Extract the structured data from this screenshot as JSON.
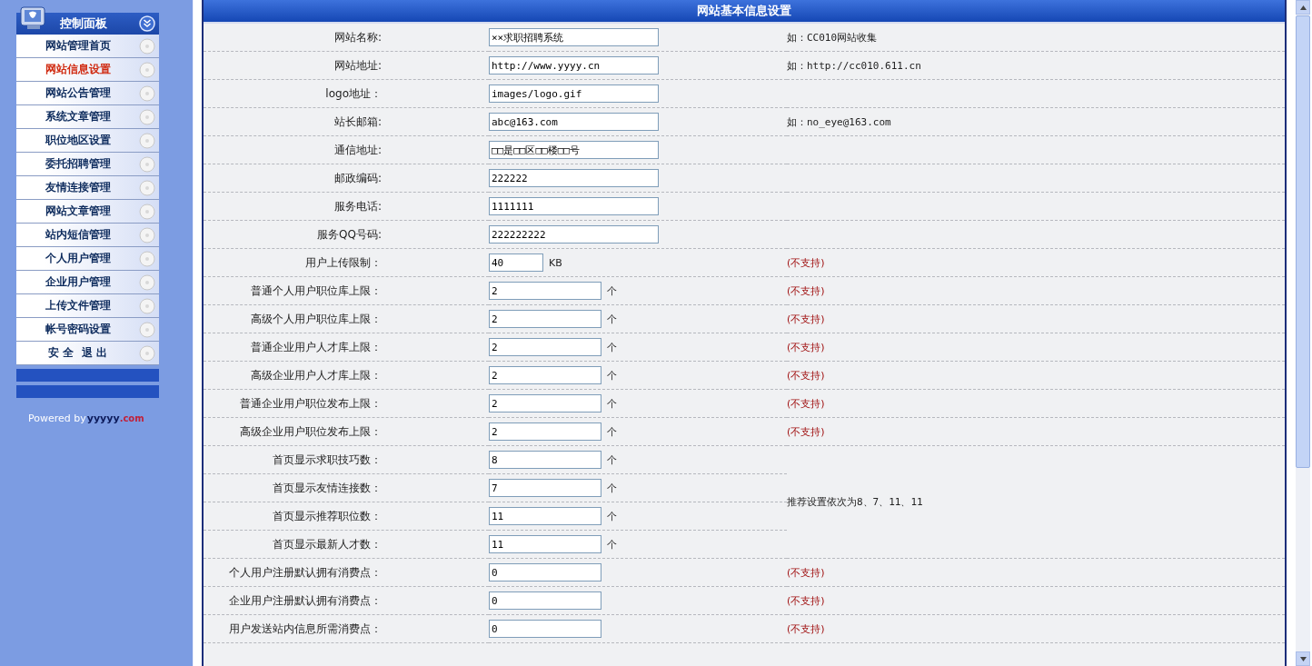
{
  "sidebar": {
    "title": "控制面板",
    "items": [
      {
        "label": "网站管理首页",
        "selected": false
      },
      {
        "label": "网站信息设置",
        "selected": true
      },
      {
        "label": "网站公告管理",
        "selected": false
      },
      {
        "label": "系统文章管理",
        "selected": false
      },
      {
        "label": "职位地区设置",
        "selected": false
      },
      {
        "label": "委托招聘管理",
        "selected": false
      },
      {
        "label": "友情连接管理",
        "selected": false
      },
      {
        "label": "网站文章管理",
        "selected": false
      },
      {
        "label": "站内短信管理",
        "selected": false
      },
      {
        "label": "个人用户管理",
        "selected": false
      },
      {
        "label": "企业用户管理",
        "selected": false
      },
      {
        "label": "上传文件管理",
        "selected": false
      },
      {
        "label": "帐号密码设置",
        "selected": false
      },
      {
        "label": "安 全  退 出",
        "selected": false
      }
    ],
    "powered_by": "Powered by",
    "brand": "yyyyy",
    "brand_suffix": ".com"
  },
  "panel": {
    "title": "网站基本信息设置",
    "rows": [
      {
        "kind": "wide",
        "label": "网站名称:",
        "value": "××求职招聘系统",
        "note": {
          "kind": "hint",
          "text": "如：CC010网站收集"
        }
      },
      {
        "kind": "wide",
        "label": "网站地址:",
        "value": "http://www.yyyy.cn",
        "note": {
          "kind": "hint",
          "text": "如：http://cc010.611.cn"
        }
      },
      {
        "kind": "wide",
        "label": "logo地址：",
        "value": "images/logo.gif"
      },
      {
        "kind": "wide",
        "label": "站长邮箱:",
        "value": "abc@163.com",
        "note": {
          "kind": "hint",
          "text": "如：no_eye@163.com"
        }
      },
      {
        "kind": "wide",
        "label": "通信地址:",
        "value": "□□是□□区□□楼□□号"
      },
      {
        "kind": "wide",
        "label": "邮政编码:",
        "value": "222222"
      },
      {
        "kind": "wide",
        "label": "服务电话:",
        "value": "1111111"
      },
      {
        "kind": "wide",
        "label": "服务QQ号码:",
        "value": "222222222"
      },
      {
        "kind": "small",
        "label": "用户上传限制：",
        "value": "40",
        "unit": "KB",
        "note": {
          "kind": "unsupported",
          "text": "(不支持)"
        }
      },
      {
        "kind": "medium",
        "label": "普通个人用户职位库上限：",
        "value": "2",
        "unit": "个",
        "note": {
          "kind": "unsupported",
          "text": "(不支持)"
        }
      },
      {
        "kind": "medium",
        "label": "高级个人用户职位库上限：",
        "value": "2",
        "unit": "个",
        "note": {
          "kind": "unsupported",
          "text": "(不支持)"
        }
      },
      {
        "kind": "medium",
        "label": "普通企业用户人才库上限：",
        "value": "2",
        "unit": "个",
        "note": {
          "kind": "unsupported",
          "text": "(不支持)"
        }
      },
      {
        "kind": "medium",
        "label": "高级企业用户人才库上限：",
        "value": "2",
        "unit": "个",
        "note": {
          "kind": "unsupported",
          "text": "(不支持)"
        }
      },
      {
        "kind": "medium",
        "label": "普通企业用户职位发布上限：",
        "value": "2",
        "unit": "个",
        "note": {
          "kind": "unsupported",
          "text": "(不支持)"
        }
      },
      {
        "kind": "medium",
        "label": "高级企业用户职位发布上限：",
        "value": "2",
        "unit": "个",
        "note": {
          "kind": "unsupported",
          "text": "(不支持)"
        }
      },
      {
        "kind": "group",
        "note": {
          "kind": "hint",
          "text": "推荐设置依次为8、7、11、11"
        },
        "rows": [
          {
            "kind": "medium",
            "label": "首页显示求职技巧数：",
            "value": "8",
            "unit": "个"
          },
          {
            "kind": "medium",
            "label": "首页显示友情连接数：",
            "value": "7",
            "unit": "个"
          },
          {
            "kind": "medium",
            "label": "首页显示推荐职位数：",
            "value": "11",
            "unit": "个"
          },
          {
            "kind": "medium",
            "label": "首页显示最新人才数：",
            "value": "11",
            "unit": "个"
          }
        ]
      },
      {
        "kind": "medium",
        "label": "个人用户注册默认拥有消费点：",
        "value": "0",
        "note": {
          "kind": "unsupported",
          "text": "(不支持)"
        }
      },
      {
        "kind": "medium",
        "label": "企业用户注册默认拥有消费点：",
        "value": "0",
        "note": {
          "kind": "unsupported",
          "text": "(不支持)"
        }
      },
      {
        "kind": "medium",
        "label": "用户发送站内信息所需消费点：",
        "value": "0",
        "note": {
          "kind": "unsupported",
          "text": "(不支持)"
        }
      }
    ]
  }
}
